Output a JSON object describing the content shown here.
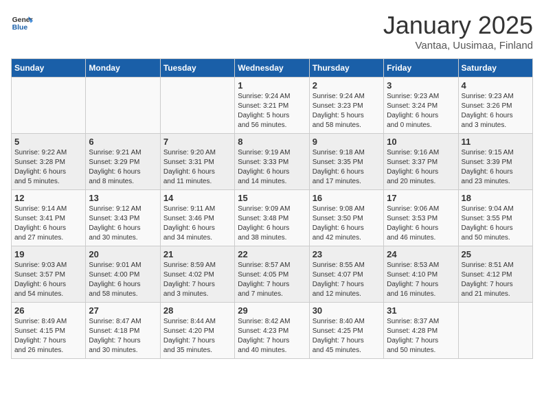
{
  "header": {
    "logo_general": "General",
    "logo_blue": "Blue",
    "month": "January 2025",
    "location": "Vantaa, Uusimaa, Finland"
  },
  "weekdays": [
    "Sunday",
    "Monday",
    "Tuesday",
    "Wednesday",
    "Thursday",
    "Friday",
    "Saturday"
  ],
  "weeks": [
    [
      {
        "day": "",
        "info": ""
      },
      {
        "day": "",
        "info": ""
      },
      {
        "day": "",
        "info": ""
      },
      {
        "day": "1",
        "info": "Sunrise: 9:24 AM\nSunset: 3:21 PM\nDaylight: 5 hours\nand 56 minutes."
      },
      {
        "day": "2",
        "info": "Sunrise: 9:24 AM\nSunset: 3:23 PM\nDaylight: 5 hours\nand 58 minutes."
      },
      {
        "day": "3",
        "info": "Sunrise: 9:23 AM\nSunset: 3:24 PM\nDaylight: 6 hours\nand 0 minutes."
      },
      {
        "day": "4",
        "info": "Sunrise: 9:23 AM\nSunset: 3:26 PM\nDaylight: 6 hours\nand 3 minutes."
      }
    ],
    [
      {
        "day": "5",
        "info": "Sunrise: 9:22 AM\nSunset: 3:28 PM\nDaylight: 6 hours\nand 5 minutes."
      },
      {
        "day": "6",
        "info": "Sunrise: 9:21 AM\nSunset: 3:29 PM\nDaylight: 6 hours\nand 8 minutes."
      },
      {
        "day": "7",
        "info": "Sunrise: 9:20 AM\nSunset: 3:31 PM\nDaylight: 6 hours\nand 11 minutes."
      },
      {
        "day": "8",
        "info": "Sunrise: 9:19 AM\nSunset: 3:33 PM\nDaylight: 6 hours\nand 14 minutes."
      },
      {
        "day": "9",
        "info": "Sunrise: 9:18 AM\nSunset: 3:35 PM\nDaylight: 6 hours\nand 17 minutes."
      },
      {
        "day": "10",
        "info": "Sunrise: 9:16 AM\nSunset: 3:37 PM\nDaylight: 6 hours\nand 20 minutes."
      },
      {
        "day": "11",
        "info": "Sunrise: 9:15 AM\nSunset: 3:39 PM\nDaylight: 6 hours\nand 23 minutes."
      }
    ],
    [
      {
        "day": "12",
        "info": "Sunrise: 9:14 AM\nSunset: 3:41 PM\nDaylight: 6 hours\nand 27 minutes."
      },
      {
        "day": "13",
        "info": "Sunrise: 9:12 AM\nSunset: 3:43 PM\nDaylight: 6 hours\nand 30 minutes."
      },
      {
        "day": "14",
        "info": "Sunrise: 9:11 AM\nSunset: 3:46 PM\nDaylight: 6 hours\nand 34 minutes."
      },
      {
        "day": "15",
        "info": "Sunrise: 9:09 AM\nSunset: 3:48 PM\nDaylight: 6 hours\nand 38 minutes."
      },
      {
        "day": "16",
        "info": "Sunrise: 9:08 AM\nSunset: 3:50 PM\nDaylight: 6 hours\nand 42 minutes."
      },
      {
        "day": "17",
        "info": "Sunrise: 9:06 AM\nSunset: 3:53 PM\nDaylight: 6 hours\nand 46 minutes."
      },
      {
        "day": "18",
        "info": "Sunrise: 9:04 AM\nSunset: 3:55 PM\nDaylight: 6 hours\nand 50 minutes."
      }
    ],
    [
      {
        "day": "19",
        "info": "Sunrise: 9:03 AM\nSunset: 3:57 PM\nDaylight: 6 hours\nand 54 minutes."
      },
      {
        "day": "20",
        "info": "Sunrise: 9:01 AM\nSunset: 4:00 PM\nDaylight: 6 hours\nand 58 minutes."
      },
      {
        "day": "21",
        "info": "Sunrise: 8:59 AM\nSunset: 4:02 PM\nDaylight: 7 hours\nand 3 minutes."
      },
      {
        "day": "22",
        "info": "Sunrise: 8:57 AM\nSunset: 4:05 PM\nDaylight: 7 hours\nand 7 minutes."
      },
      {
        "day": "23",
        "info": "Sunrise: 8:55 AM\nSunset: 4:07 PM\nDaylight: 7 hours\nand 12 minutes."
      },
      {
        "day": "24",
        "info": "Sunrise: 8:53 AM\nSunset: 4:10 PM\nDaylight: 7 hours\nand 16 minutes."
      },
      {
        "day": "25",
        "info": "Sunrise: 8:51 AM\nSunset: 4:12 PM\nDaylight: 7 hours\nand 21 minutes."
      }
    ],
    [
      {
        "day": "26",
        "info": "Sunrise: 8:49 AM\nSunset: 4:15 PM\nDaylight: 7 hours\nand 26 minutes."
      },
      {
        "day": "27",
        "info": "Sunrise: 8:47 AM\nSunset: 4:18 PM\nDaylight: 7 hours\nand 30 minutes."
      },
      {
        "day": "28",
        "info": "Sunrise: 8:44 AM\nSunset: 4:20 PM\nDaylight: 7 hours\nand 35 minutes."
      },
      {
        "day": "29",
        "info": "Sunrise: 8:42 AM\nSunset: 4:23 PM\nDaylight: 7 hours\nand 40 minutes."
      },
      {
        "day": "30",
        "info": "Sunrise: 8:40 AM\nSunset: 4:25 PM\nDaylight: 7 hours\nand 45 minutes."
      },
      {
        "day": "31",
        "info": "Sunrise: 8:37 AM\nSunset: 4:28 PM\nDaylight: 7 hours\nand 50 minutes."
      },
      {
        "day": "",
        "info": ""
      }
    ]
  ]
}
